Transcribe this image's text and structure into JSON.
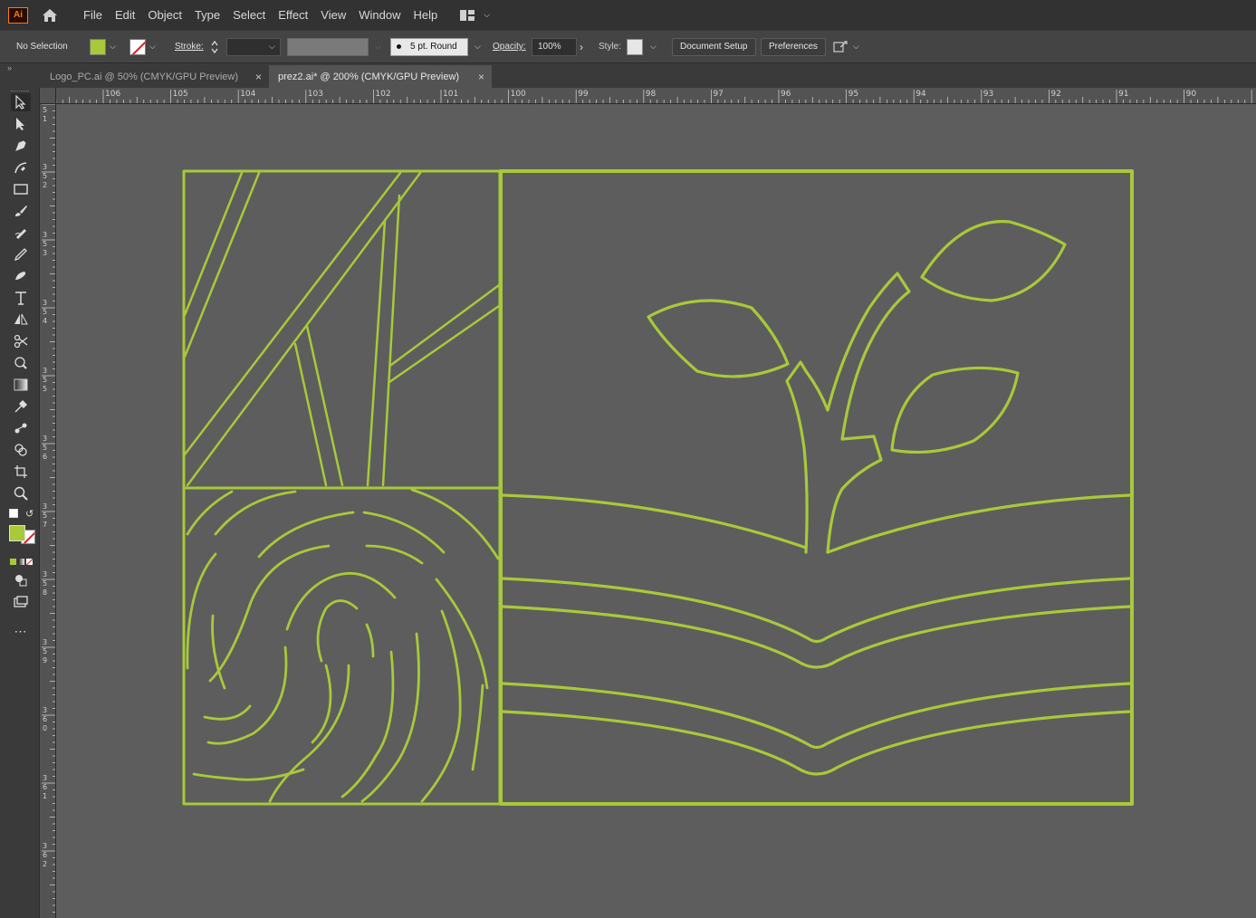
{
  "app": {
    "logo": "Ai"
  },
  "menu": [
    "File",
    "Edit",
    "Object",
    "Type",
    "Select",
    "Effect",
    "View",
    "Window",
    "Help"
  ],
  "control": {
    "selection": "No Selection",
    "stroke_label": "Stroke:",
    "brush": "5 pt. Round",
    "opacity_label": "Opacity:",
    "opacity_value": "100%",
    "style_label": "Style:",
    "document_setup": "Document Setup",
    "preferences": "Preferences"
  },
  "tabs": [
    {
      "label": "Logo_PC.ai @ 50% (CMYK/GPU Preview)"
    },
    {
      "label": "prez2.ai* @ 200% (CMYK/GPU Preview)"
    }
  ],
  "ruler_top": [
    "106",
    "105",
    "104",
    "103",
    "102",
    "101",
    "100",
    "99",
    "98",
    "97",
    "96",
    "95",
    "94",
    "93",
    "92",
    "91",
    "90"
  ],
  "ruler_left": [
    "5\n1",
    "3\n5\n2",
    "3\n5\n3",
    "3\n5\n4",
    "3\n5\n5",
    "3\n5\n6",
    "3\n5\n7",
    "3\n5\n8",
    "3\n5\n9",
    "3\n6\n0",
    "3\n6\n1",
    "3\n6\n2"
  ],
  "colors": {
    "accent": "#a8c93a",
    "canvas": "#5d5d5d",
    "chrome": "#323232"
  },
  "icons": [
    "home-icon",
    "selection-tool-icon",
    "direct-selection-icon",
    "pen-tool-icon",
    "curvature-tool-icon",
    "rectangle-tool-icon",
    "paintbrush-icon",
    "pencil-icon",
    "eraser-icon",
    "rotate-icon",
    "type-tool-icon",
    "reflect-icon",
    "scissors-icon",
    "width-tool-icon",
    "gradient-icon",
    "eyedropper-icon",
    "blend-icon",
    "shape-builder-icon",
    "artboard-icon",
    "zoom-icon",
    "more-tools-icon"
  ]
}
